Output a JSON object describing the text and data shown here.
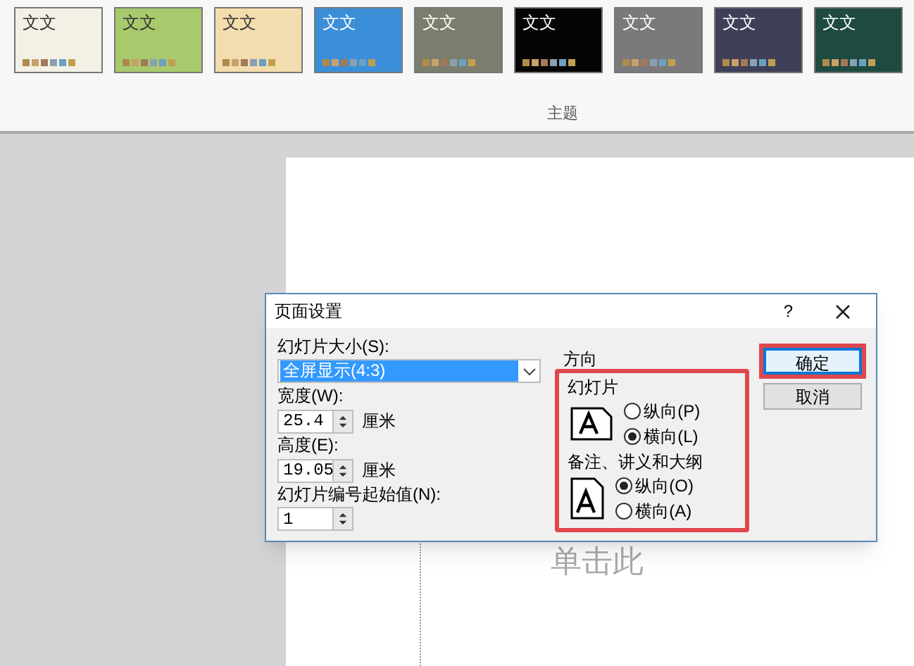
{
  "ribbon": {
    "themes": [
      {
        "sample": "文文",
        "color": "#f3f1e6",
        "kind": "light"
      },
      {
        "sample": "文文",
        "color": "#a8c96c",
        "kind": "light"
      },
      {
        "sample": "文文",
        "color": "#f3dcae",
        "kind": "light"
      },
      {
        "sample": "文文",
        "color": "#3b8fd9",
        "kind": "dark"
      },
      {
        "sample": "文文",
        "color": "#7b7e6c",
        "kind": "dark"
      },
      {
        "sample": "文文",
        "color": "#050505",
        "kind": "dark"
      },
      {
        "sample": "文文",
        "color": "#7a7a7c",
        "kind": "dark"
      },
      {
        "sample": "文文",
        "color": "#3f3f57",
        "kind": "dark"
      },
      {
        "sample": "文文",
        "color": "#1e4a41",
        "kind": "dark"
      }
    ],
    "group_label": "主题"
  },
  "slide": {
    "placeholder_text": "单击此"
  },
  "dialog": {
    "title": "页面设置",
    "help": "?",
    "size_label": "幻灯片大小(S):",
    "size_value": "全屏显示(4:3)",
    "width_label": "宽度(W):",
    "width_value": "25.4",
    "width_unit": "厘米",
    "height_label": "高度(E):",
    "height_value": "19.05",
    "height_unit": "厘米",
    "start_label": "幻灯片编号起始值(N):",
    "start_value": "1",
    "orientation_label": "方向",
    "groups": [
      {
        "title": "幻灯片",
        "options": [
          {
            "label": "纵向(P)",
            "selected": false
          },
          {
            "label": "横向(L)",
            "selected": true
          }
        ]
      },
      {
        "title": "备注、讲义和大纲",
        "options": [
          {
            "label": "纵向(O)",
            "selected": true
          },
          {
            "label": "横向(A)",
            "selected": false
          }
        ]
      }
    ],
    "buttons": [
      {
        "label": "确定",
        "default": true
      },
      {
        "label": "取消",
        "default": false
      }
    ]
  }
}
